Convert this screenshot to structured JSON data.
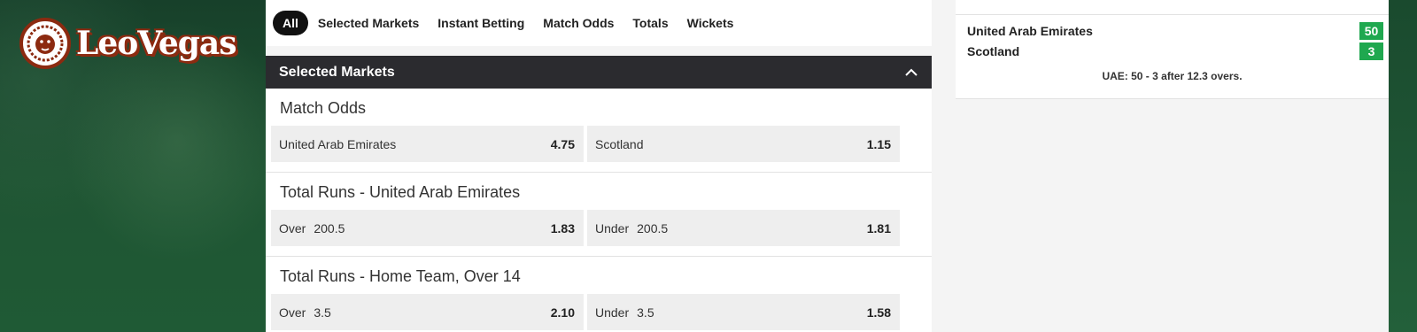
{
  "brand": {
    "name": "LeoVegas",
    "accent": "#8c2a10"
  },
  "tabs": [
    {
      "label": "All",
      "active": true
    },
    {
      "label": "Selected Markets",
      "active": false
    },
    {
      "label": "Instant Betting",
      "active": false
    },
    {
      "label": "Match Odds",
      "active": false
    },
    {
      "label": "Totals",
      "active": false
    },
    {
      "label": "Wickets",
      "active": false
    }
  ],
  "section": {
    "title": "Selected Markets",
    "expanded": true,
    "icon": "chevron-up-icon"
  },
  "markets": [
    {
      "title": "Match Odds",
      "outcomes": [
        {
          "label": "United Arab Emirates",
          "line": "",
          "odds": "4.75"
        },
        {
          "label": "Scotland",
          "line": "",
          "odds": "1.15"
        }
      ]
    },
    {
      "title": "Total Runs - United Arab Emirates",
      "outcomes": [
        {
          "label": "Over",
          "line": "200.5",
          "odds": "1.83"
        },
        {
          "label": "Under",
          "line": "200.5",
          "odds": "1.81"
        }
      ]
    },
    {
      "title": "Total Runs - Home Team, Over 14",
      "outcomes": [
        {
          "label": "Over",
          "line": "3.5",
          "odds": "2.10"
        },
        {
          "label": "Under",
          "line": "3.5",
          "odds": "1.58"
        }
      ]
    }
  ],
  "scoreboard": {
    "teams": [
      {
        "name": "United Arab Emirates",
        "score": "50"
      },
      {
        "name": "Scotland",
        "score": "3"
      }
    ],
    "status": "UAE: 50 - 3 after 12.3 overs.",
    "score_color": "#1fa84f"
  }
}
